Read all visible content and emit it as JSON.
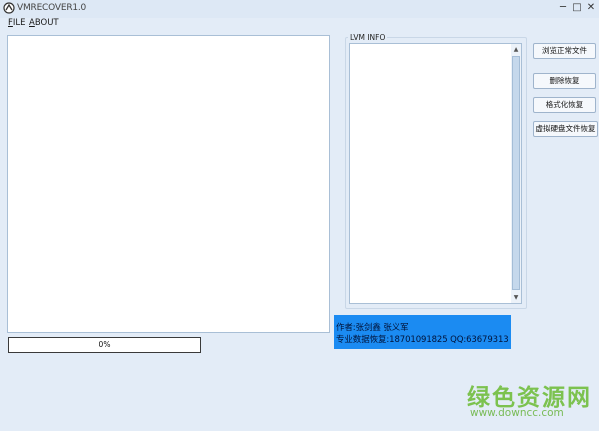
{
  "window": {
    "title": "VMRECOVER1.0",
    "controls": {
      "minimize": "─",
      "maximize": "□",
      "close": "✕"
    }
  },
  "menu": [
    {
      "accel": "F",
      "rest": "ILE"
    },
    {
      "accel": "A",
      "rest": "BOUT"
    }
  ],
  "lvm_group": {
    "label": "LVM INFO"
  },
  "scrollbar": {
    "up_arrow": "▲",
    "down_arrow": "▼"
  },
  "buttons": {
    "browse": "浏览正常文件",
    "delete_recover": "删除恢复",
    "format_recover": "格式化恢复",
    "vdisk_recover": "虚拟硬盘文件恢复"
  },
  "progress": {
    "value": 0,
    "label": "0%"
  },
  "author_info": {
    "line1": "作者:张剑鑫  张义军",
    "line2": "专业数据恢复:18701091825  QQ:63679313"
  },
  "watermark": {
    "text": "绿色资源网",
    "url": "www.downcc.com"
  },
  "colors": {
    "background": "#e3ecf7",
    "author_box": "#1b8bf2",
    "watermark": "#7cc24f"
  }
}
